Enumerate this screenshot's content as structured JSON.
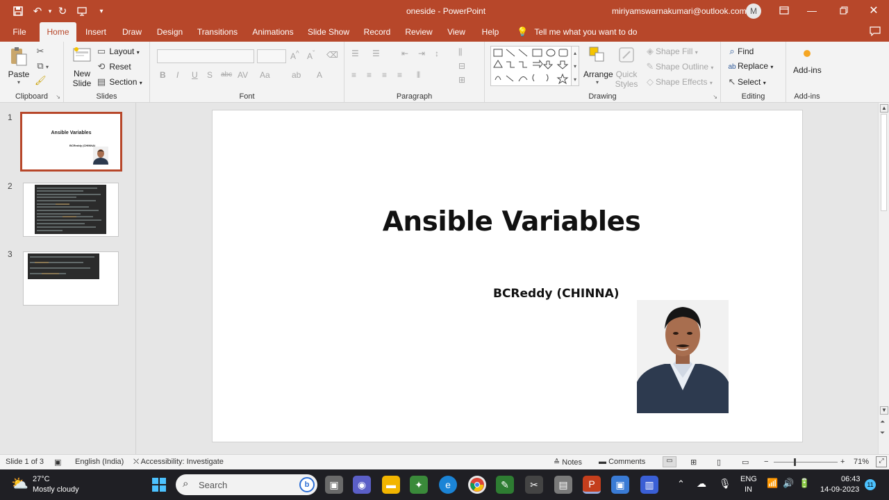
{
  "window": {
    "title": "oneside  -  PowerPoint",
    "user_email": "miriyamswarnakumari@outlook.com",
    "avatar_letter": "M"
  },
  "tabs": [
    {
      "label": "File"
    },
    {
      "label": "Home"
    },
    {
      "label": "Insert"
    },
    {
      "label": "Draw"
    },
    {
      "label": "Design"
    },
    {
      "label": "Transitions"
    },
    {
      "label": "Animations"
    },
    {
      "label": "Slide Show"
    },
    {
      "label": "Record"
    },
    {
      "label": "Review"
    },
    {
      "label": "View"
    },
    {
      "label": "Help"
    }
  ],
  "tell_me": "Tell me what you want to do",
  "ribbon": {
    "clipboard": {
      "label": "Clipboard",
      "paste": "Paste"
    },
    "slides": {
      "label": "Slides",
      "new_slide_1": "New",
      "new_slide_2": "Slide",
      "layout": "Layout",
      "reset": "Reset",
      "section": "Section"
    },
    "font": {
      "label": "Font"
    },
    "paragraph": {
      "label": "Paragraph"
    },
    "drawing": {
      "label": "Drawing",
      "arrange": "Arrange",
      "quick_1": "Quick",
      "quick_2": "Styles",
      "shape_fill": "Shape Fill",
      "shape_outline": "Shape Outline",
      "shape_effects": "Shape Effects"
    },
    "editing": {
      "label": "Editing",
      "find": "Find",
      "replace": "Replace",
      "select": "Select"
    },
    "addins": {
      "label": "Add-ins",
      "addins": "Add-ins"
    }
  },
  "thumbnails": [
    {
      "num": "1",
      "title": "Ansible Variables",
      "sub": "BCReddy (CHINNA)"
    },
    {
      "num": "2"
    },
    {
      "num": "3"
    }
  ],
  "slide": {
    "title": "Ansible Variables",
    "subtitle": "BCReddy (CHINNA)"
  },
  "status": {
    "slide_info": "Slide 1 of 3",
    "language": "English (India)",
    "accessibility": "Accessibility: Investigate",
    "notes": "Notes",
    "comments": "Comments",
    "zoom": "71%"
  },
  "taskbar": {
    "temp": "27°C",
    "weather": "Mostly cloudy",
    "search": "Search",
    "lang_1": "ENG",
    "lang_2": "IN",
    "time": "06:43",
    "date": "14-09-2023",
    "notif": "11"
  },
  "colors": {
    "accent": "#b7472a",
    "taskbar": "#1f1f24"
  }
}
